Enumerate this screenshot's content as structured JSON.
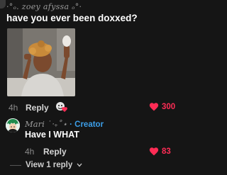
{
  "comment": {
    "username": "·°ₒ. zoey afyssa ₒ°·",
    "text": "have you ever been doxxed?",
    "time": "4h",
    "reply_label": "Reply",
    "likes": "300",
    "reaction_icon": "emoji-reaction-icon"
  },
  "reply": {
    "username": "Mari ˙‧₊˚⋆",
    "creator_sep": "·",
    "creator_label": "Creator",
    "text": "Have I WHAT",
    "time": "4h",
    "reply_label": "Reply",
    "likes": "83"
  },
  "thread": {
    "view_replies": "View 1 reply"
  },
  "colors": {
    "background": "#151515",
    "like": "#fe2c55",
    "creator": "#3c9ee8"
  }
}
